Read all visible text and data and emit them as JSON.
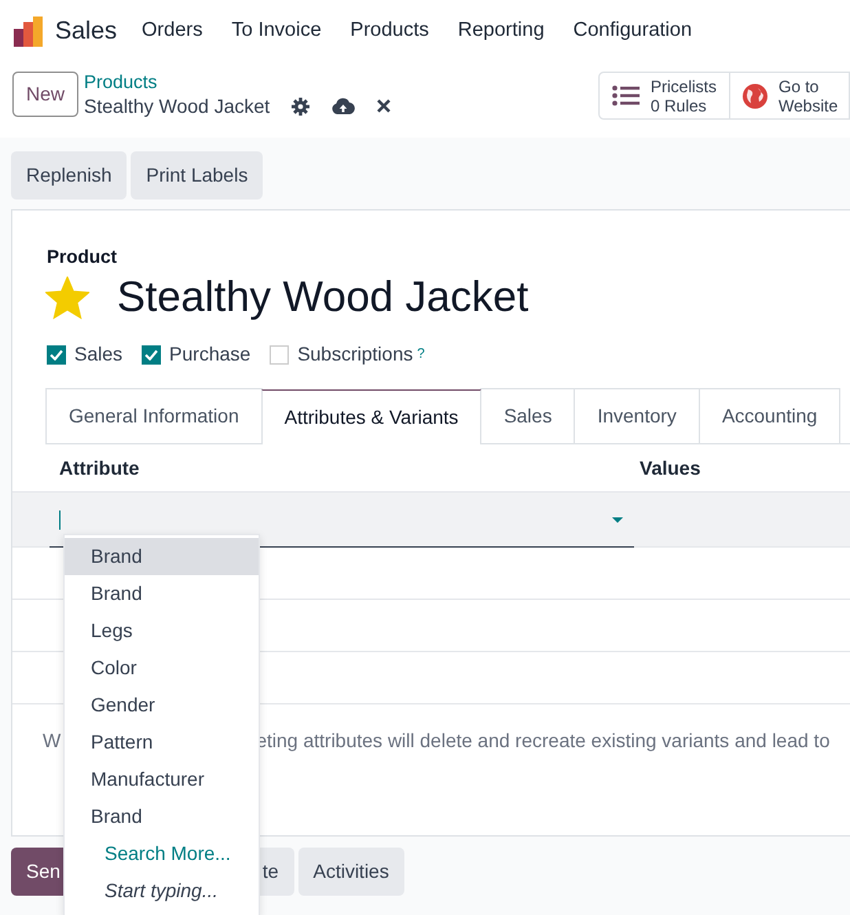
{
  "navbar": {
    "app": "Sales",
    "menus": [
      "Orders",
      "To Invoice",
      "Products",
      "Reporting",
      "Configuration"
    ]
  },
  "breadcrumb": {
    "new_button": "New",
    "parent": "Products",
    "current": "Stealthy Wood Jacket"
  },
  "smart_buttons": [
    {
      "kind": "list",
      "label": "Pricelists",
      "value": "0 Rules"
    },
    {
      "kind": "globe",
      "label": "Go to Website"
    }
  ],
  "actions": [
    "Replenish",
    "Print Labels"
  ],
  "form": {
    "label": "Product",
    "title": "Stealthy Wood Jacket",
    "starred": true,
    "options": [
      {
        "label": "Sales",
        "checked": true
      },
      {
        "label": "Purchase",
        "checked": true
      },
      {
        "label": "Subscriptions",
        "checked": false,
        "help": "?"
      }
    ],
    "tabs": [
      {
        "label": "General Information",
        "selected": false
      },
      {
        "label": "Attributes & Variants",
        "selected": true
      },
      {
        "label": "Sales",
        "selected": false
      },
      {
        "label": "Inventory",
        "selected": false
      },
      {
        "label": "Accounting",
        "selected": false
      }
    ],
    "table": {
      "columns": [
        "Attribute",
        "Values"
      ],
      "rows": [
        {
          "kind": "edit"
        },
        {
          "kind": "blank"
        },
        {
          "kind": "blank"
        },
        {
          "kind": "blank"
        }
      ]
    },
    "note": [
      "W",
      "eting attributes will delete and recreate existing variants and lead to"
    ]
  },
  "dropdown": [
    {
      "kind": "option",
      "label": "Brand",
      "selected": true
    },
    {
      "kind": "option",
      "label": "Brand",
      "selected": false
    },
    {
      "kind": "option",
      "label": "Legs",
      "selected": false
    },
    {
      "kind": "option",
      "label": "Color",
      "selected": false
    },
    {
      "kind": "option",
      "label": "Gender",
      "selected": false
    },
    {
      "kind": "option",
      "label": "Pattern",
      "selected": false
    },
    {
      "kind": "option",
      "label": "Manufacturer",
      "selected": false
    },
    {
      "kind": "option",
      "label": "Brand",
      "selected": false
    },
    {
      "kind": "search",
      "label": "Search More..."
    },
    {
      "kind": "hint",
      "label": "Start typing..."
    }
  ],
  "chatter": [
    {
      "kind": "primary",
      "label": "Sen"
    },
    {
      "kind": "secondary",
      "label": "te"
    },
    {
      "kind": "secondary",
      "label": "Activities"
    }
  ]
}
